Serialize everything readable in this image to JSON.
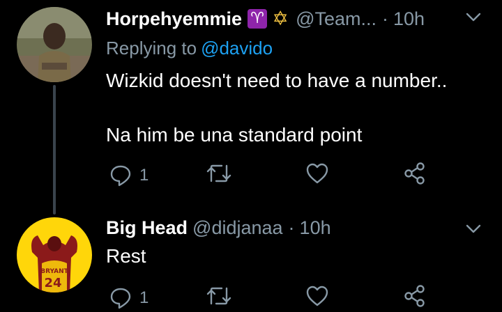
{
  "tweets": [
    {
      "name": "Horpehyemmie",
      "badges": [
        "aries-badge",
        "star-of-david-badge"
      ],
      "badge_glyphs": {
        "aries": "♈",
        "star": "✡"
      },
      "handle": "@Team...",
      "separator": "·",
      "time": "10h",
      "replying_prefix": "Replying to",
      "replying_to": "@davido",
      "lines": [
        "Wizkid doesn't need to have a number..",
        "Na him be una standard point"
      ],
      "reply_count": "1"
    },
    {
      "name": "Big Head",
      "handle": "@didjanaa",
      "separator": "·",
      "time": "10h",
      "text": "Rest",
      "reply_count": "1",
      "jersey_text": "BRYANT",
      "jersey_number": "24"
    }
  ],
  "colors": {
    "background": "#000000",
    "text": "#ffffff",
    "secondary": "#8899a6",
    "link": "#1da1f2",
    "thread_line": "#3a444d",
    "avatar2_bg": "#ffd60a"
  }
}
